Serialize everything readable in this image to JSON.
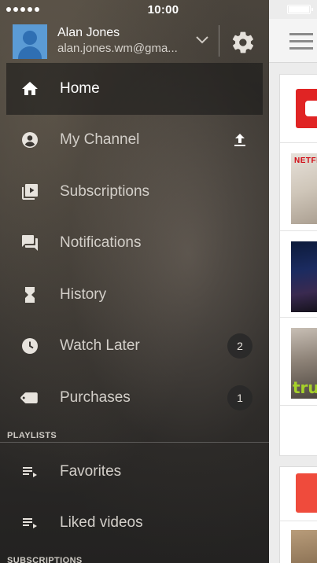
{
  "status_bar": {
    "time": "10:00"
  },
  "account": {
    "name": "Alan Jones",
    "email": "alan.jones.wm@gma..."
  },
  "nav": {
    "items": [
      {
        "label": "Home",
        "icon": "home-icon",
        "active": true
      },
      {
        "label": "My Channel",
        "icon": "person-icon"
      },
      {
        "label": "Subscriptions",
        "icon": "subscriptions-icon"
      },
      {
        "label": "Notifications",
        "icon": "chat-icon"
      },
      {
        "label": "History",
        "icon": "hourglass-icon"
      },
      {
        "label": "Watch Later",
        "icon": "clock-icon",
        "badge": "2"
      },
      {
        "label": "Purchases",
        "icon": "tag-icon",
        "badge": "1"
      }
    ]
  },
  "playlists": {
    "header": "PLAYLISTS",
    "items": [
      {
        "label": "Favorites",
        "icon": "playlist-icon"
      },
      {
        "label": "Liked videos",
        "icon": "playlist-icon"
      }
    ]
  },
  "subscriptions": {
    "header": "SUBSCRIPTIONS"
  },
  "content": {
    "thumb1_text": "NETFLI",
    "thumb3_text": "tru"
  },
  "colors": {
    "accent": "#e02424",
    "badge_bg": "#2a2a2a"
  }
}
